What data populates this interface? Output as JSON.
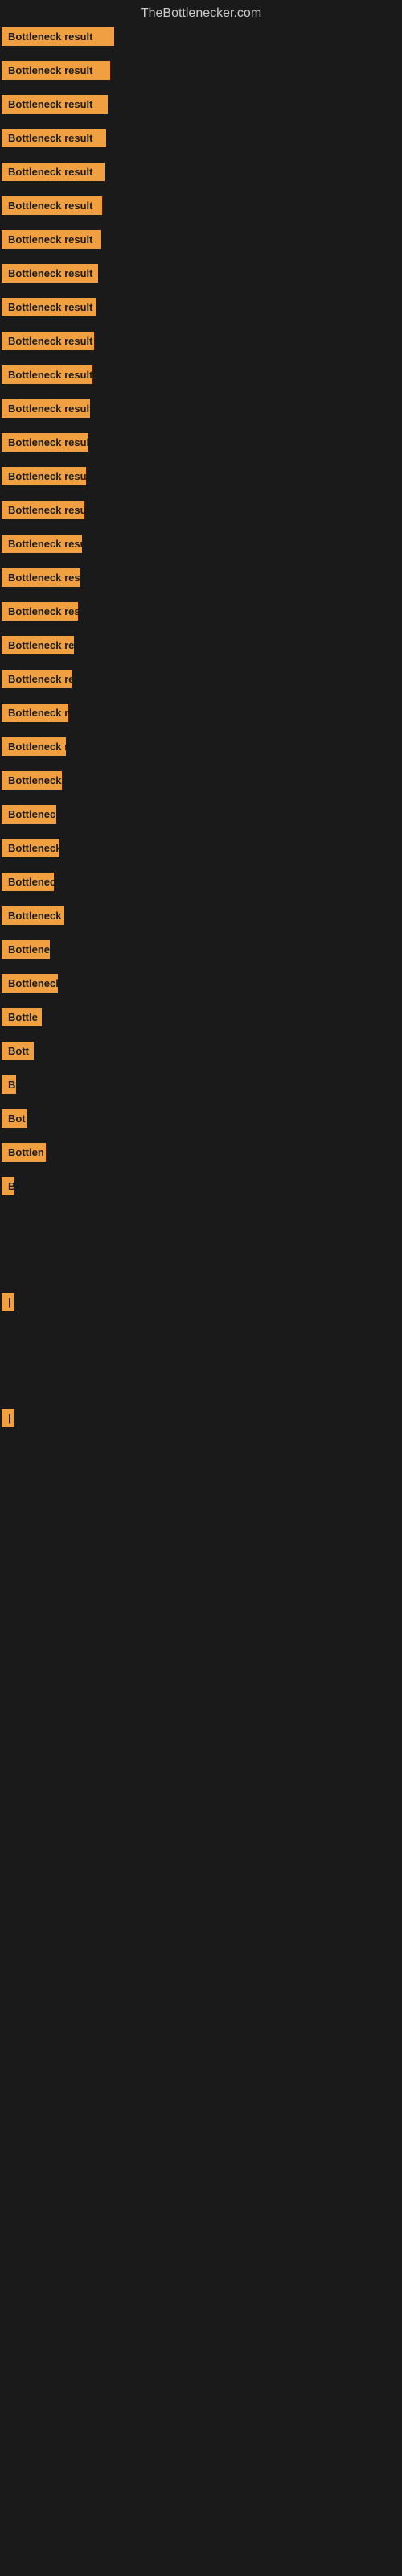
{
  "site_title": "TheBottlenecker.com",
  "bars": [
    {
      "label": "Bottleneck result",
      "width": 140
    },
    {
      "label": "Bottleneck result",
      "width": 135
    },
    {
      "label": "Bottleneck result",
      "width": 132
    },
    {
      "label": "Bottleneck result",
      "width": 130
    },
    {
      "label": "Bottleneck result",
      "width": 128
    },
    {
      "label": "Bottleneck result",
      "width": 125
    },
    {
      "label": "Bottleneck result",
      "width": 123
    },
    {
      "label": "Bottleneck result",
      "width": 120
    },
    {
      "label": "Bottleneck result",
      "width": 118
    },
    {
      "label": "Bottleneck result",
      "width": 115
    },
    {
      "label": "Bottleneck result",
      "width": 113
    },
    {
      "label": "Bottleneck result",
      "width": 110
    },
    {
      "label": "Bottleneck result",
      "width": 108
    },
    {
      "label": "Bottleneck result",
      "width": 105
    },
    {
      "label": "Bottleneck result",
      "width": 103
    },
    {
      "label": "Bottleneck result",
      "width": 100
    },
    {
      "label": "Bottleneck result",
      "width": 98
    },
    {
      "label": "Bottleneck result",
      "width": 95
    },
    {
      "label": "Bottleneck result",
      "width": 90
    },
    {
      "label": "Bottleneck result",
      "width": 87
    },
    {
      "label": "Bottleneck resu",
      "width": 83
    },
    {
      "label": "Bottleneck result",
      "width": 80
    },
    {
      "label": "Bottleneck re",
      "width": 75
    },
    {
      "label": "Bottleneck",
      "width": 68
    },
    {
      "label": "Bottleneck res",
      "width": 72
    },
    {
      "label": "Bottleneck r",
      "width": 65
    },
    {
      "label": "Bottleneck resu",
      "width": 78
    },
    {
      "label": "Bottlenec",
      "width": 60
    },
    {
      "label": "Bottleneck re",
      "width": 70
    },
    {
      "label": "Bottle",
      "width": 50
    },
    {
      "label": "Bott",
      "width": 40
    },
    {
      "label": "B",
      "width": 18
    },
    {
      "label": "Bot",
      "width": 32
    },
    {
      "label": "Bottlen",
      "width": 55
    },
    {
      "label": "B",
      "width": 16
    },
    {
      "label": "",
      "width": 0
    },
    {
      "label": "",
      "width": 0
    },
    {
      "label": "",
      "width": 0
    },
    {
      "label": "|",
      "width": 10
    },
    {
      "label": "",
      "width": 0
    },
    {
      "label": "",
      "width": 0
    },
    {
      "label": "",
      "width": 0
    },
    {
      "label": "|",
      "width": 10
    }
  ]
}
